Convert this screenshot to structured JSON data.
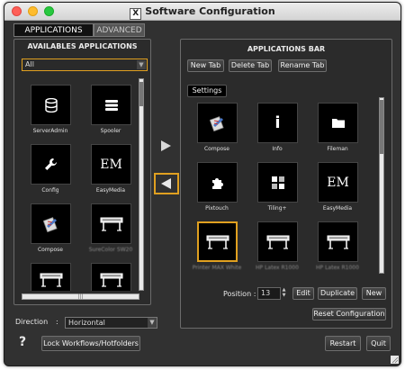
{
  "window": {
    "title": "Software Configuration"
  },
  "tabs": [
    {
      "label": "APPLICATIONS",
      "active": true
    },
    {
      "label": "ADVANCED",
      "active": false
    }
  ],
  "available": {
    "title": "AVAILABLES APPLICATIONS",
    "filter_value": "All",
    "items": [
      {
        "label": "ServerAdmin",
        "icon": "database-icon",
        "glyph": ""
      },
      {
        "label": "Spooler",
        "icon": "list-icon",
        "glyph": ""
      },
      {
        "label": "Config",
        "icon": "wrench-icon",
        "glyph": ""
      },
      {
        "label": "EasyMedia",
        "icon": "easymedia-icon",
        "glyph": "EM"
      },
      {
        "label": "Compose",
        "icon": "compose-icon",
        "glyph": ""
      },
      {
        "label": "SureColor SW20",
        "icon": "printer-icon",
        "glyph": ""
      },
      {
        "label": "",
        "icon": "printer-icon",
        "glyph": ""
      },
      {
        "label": "",
        "icon": "printer-icon",
        "glyph": ""
      }
    ]
  },
  "bar": {
    "title": "APPLICATIONS BAR",
    "new_tab": "New Tab",
    "delete_tab": "Delete Tab",
    "rename_tab": "Rename Tab",
    "current_tab": "Settings",
    "items": [
      {
        "label": "Compose",
        "icon": "compose-icon",
        "glyph": ""
      },
      {
        "label": "Info",
        "icon": "info-icon",
        "glyph": "i"
      },
      {
        "label": "Fileman",
        "icon": "folder-icon",
        "glyph": ""
      },
      {
        "label": "Pixtouch",
        "icon": "puzzle-icon",
        "glyph": ""
      },
      {
        "label": "Tiling+",
        "icon": "tiling-icon",
        "glyph": ""
      },
      {
        "label": "EasyMedia",
        "icon": "easymedia-icon",
        "glyph": "EM"
      },
      {
        "label": "Printer MAX White",
        "icon": "printer-icon",
        "glyph": "",
        "selected": true
      },
      {
        "label": "HP Latex R1000",
        "icon": "printer-icon",
        "glyph": ""
      },
      {
        "label": "HP Latex R1000",
        "icon": "printer-icon",
        "glyph": ""
      }
    ],
    "position_label": "Position :",
    "position_value": "13",
    "edit": "Edit",
    "duplicate": "Duplicate",
    "new": "New",
    "reset": "Reset Configuration"
  },
  "direction": {
    "label": "Direction",
    "separator": ":",
    "value": "Horizontal"
  },
  "help": "?",
  "lock": "Lock Workflows/Hotfolders",
  "restart": "Restart",
  "quit": "Quit",
  "colors": {
    "accent": "#e0a020",
    "background": "#313131"
  }
}
